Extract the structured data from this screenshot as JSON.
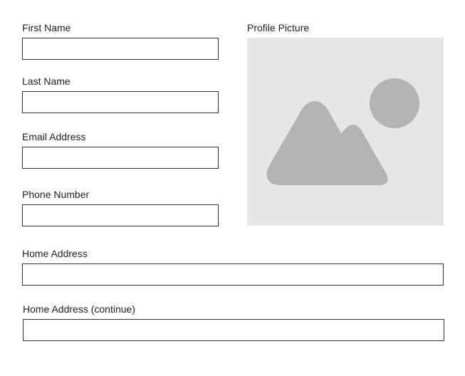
{
  "form": {
    "first_name": {
      "label": "First Name",
      "value": "",
      "placeholder": ""
    },
    "last_name": {
      "label": "Last Name",
      "value": "",
      "placeholder": ""
    },
    "email": {
      "label": "Email Address",
      "value": "",
      "placeholder": ""
    },
    "phone": {
      "label": "Phone Number",
      "value": "",
      "placeholder": ""
    },
    "home_address": {
      "label": "Home Address",
      "value": "",
      "placeholder": ""
    },
    "home_address_2": {
      "label": "Home Address (continue)",
      "value": "",
      "placeholder": ""
    },
    "profile_picture": {
      "label": "Profile Picture",
      "icon": "image-placeholder-icon",
      "colors": {
        "background": "#e6e6e6",
        "glyph": "#b3b3b3"
      }
    }
  }
}
